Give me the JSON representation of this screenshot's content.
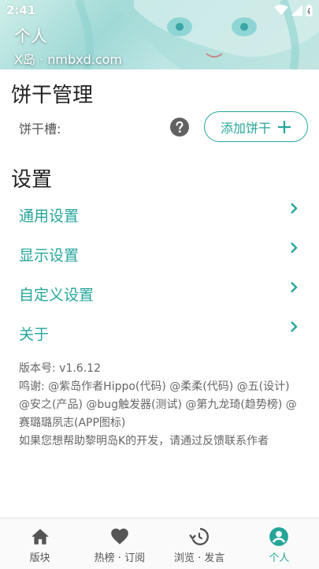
{
  "status_bar": {
    "time": "2:41"
  },
  "header": {
    "title": "个人",
    "subtitle": "X岛 · nmbxd.com"
  },
  "cookie_section": {
    "title": "饼干管理",
    "slot_label": "饼干槽:",
    "add_button_label": "添加饼干"
  },
  "settings_section": {
    "title": "设置",
    "items": [
      {
        "label": "通用设置"
      },
      {
        "label": "显示设置"
      },
      {
        "label": "自定义设置"
      },
      {
        "label": "关于"
      }
    ]
  },
  "about": {
    "version": "版本号: v1.6.12",
    "thanks": "鸣谢: @紫岛作者Hippo(代码) @柔柔(代码) @五(设计) @安之(产品) @bug触发器(测试) @第九龙琦(趋势榜) @赛璐璐夙志(APP图标)",
    "contact": "如果您想帮助黎明岛K的开发，请通过反馈联系作者"
  },
  "bottom_nav": {
    "items": [
      {
        "label": "版块",
        "icon": "home-icon"
      },
      {
        "label": "热榜 · 订阅",
        "icon": "heart-icon"
      },
      {
        "label": "浏览 · 发言",
        "icon": "history-icon"
      },
      {
        "label": "个人",
        "icon": "account-icon"
      }
    ],
    "active_index": 3
  },
  "colors": {
    "accent": "#26a69a",
    "text": "#222222",
    "muted": "#666666"
  }
}
